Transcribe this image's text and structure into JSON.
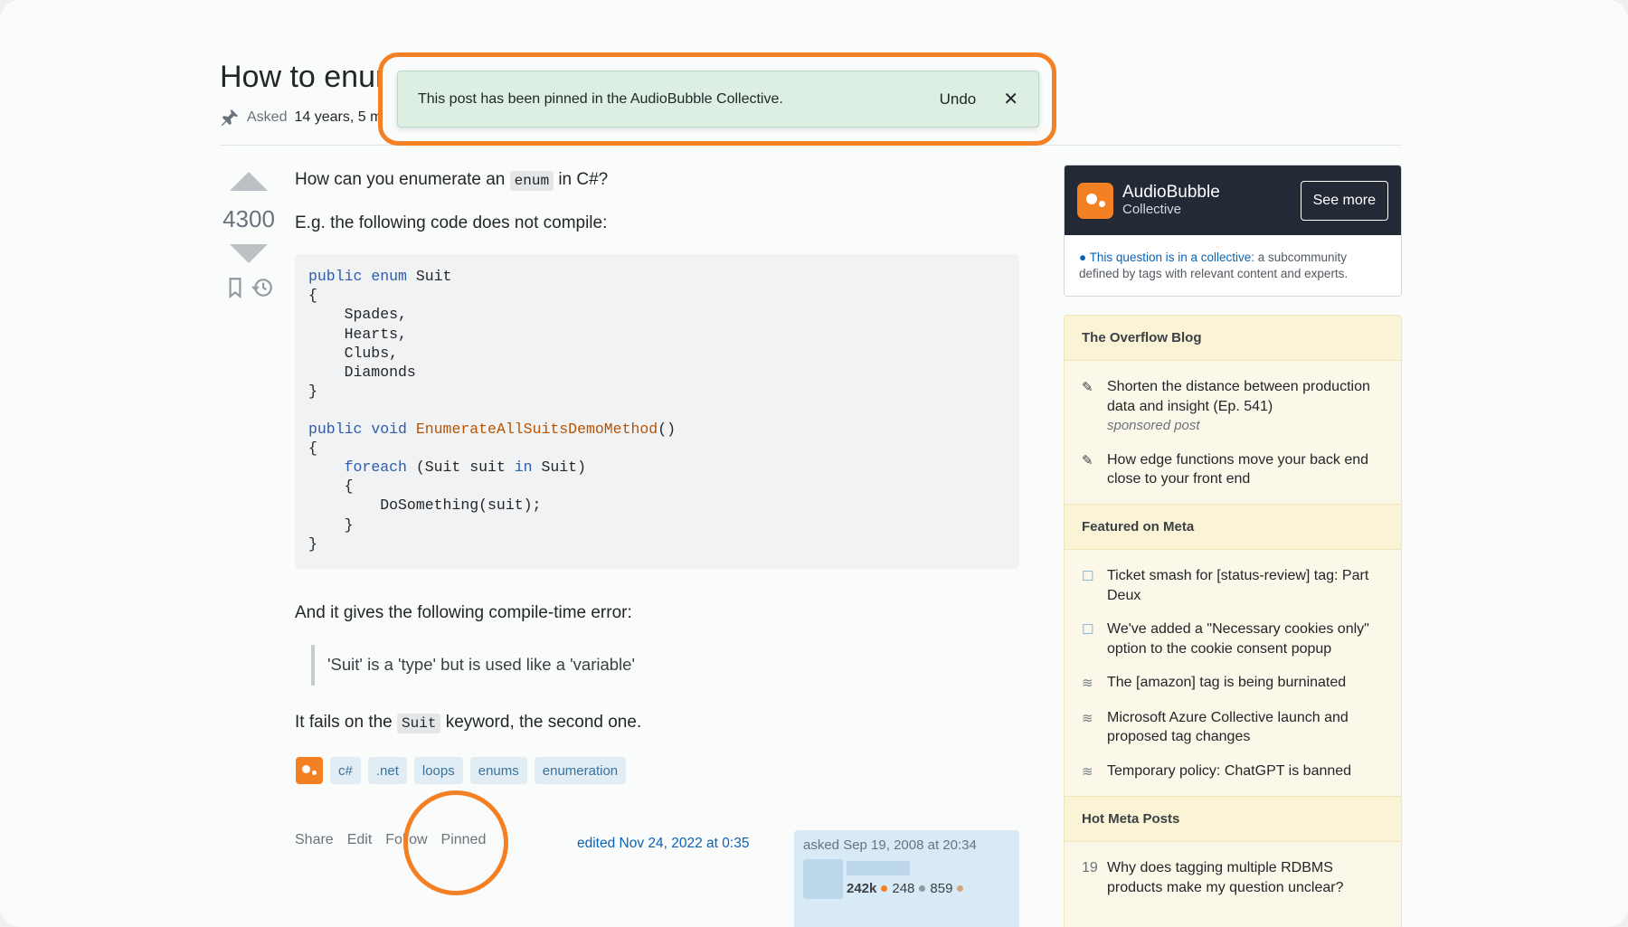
{
  "question": {
    "title": "How to enumerate an enum?",
    "asked_label": "Asked",
    "asked_value": "14 years, 5 months ago",
    "score": "4300",
    "body": {
      "p1_before": "How can you enumerate an ",
      "p1_code": "enum",
      "p1_after": " in C#?",
      "p2": "E.g. the following code does not compile:",
      "p3": "And it gives the following compile-time error:",
      "quote": "'Suit' is a 'type' but is used like a 'variable'",
      "p4_before": "It fails on the ",
      "p4_code": "Suit",
      "p4_after": " keyword, the second one."
    },
    "code": {
      "l1_kw1": "public",
      "l1_kw2": "enum",
      "l1_rest": " Suit",
      "l2": "{",
      "l3": "    Spades,",
      "l4": "    Hearts,",
      "l5": "    Clubs,",
      "l6": "    Diamonds",
      "l7": "}",
      "l9_kw1": "public",
      "l9_kw2": "void",
      "l9_fn": "EnumerateAllSuitsDemoMethod",
      "l9_rest": "()",
      "l10": "{",
      "l11_kw": "foreach",
      "l11_mid": " (Suit suit ",
      "l11_kw2": "in",
      "l11_rest": " Suit)",
      "l12": "    {",
      "l13": "        DoSomething(suit);",
      "l14": "    }",
      "l15": "}"
    },
    "tags": [
      "c#",
      ".net",
      "loops",
      "enums",
      "enumeration"
    ],
    "actions": [
      "Share",
      "Edit",
      "Follow",
      "Pinned"
    ],
    "edited": "edited Nov 24, 2022 at 0:35",
    "asked_on": "asked Sep 19, 2008 at 20:34",
    "owner_rep": "242k",
    "owner_silver": "248",
    "owner_bronze": "859"
  },
  "toast": {
    "message": "This post has been pinned in the AudioBubble Collective.",
    "undo": "Undo",
    "close": "✕"
  },
  "collective": {
    "name": "AudioBubble",
    "sub": "Collective",
    "see_more": "See more",
    "note_link": "This question is in a collective:",
    "note_rest": " a subcommunity defined by tags with relevant content and experts."
  },
  "sidebar": {
    "blog_title": "The Overflow Blog",
    "blog_items": [
      {
        "text": "Shorten the distance between production data and insight (Ep. 541)",
        "sub": "sponsored post"
      },
      {
        "text": "How edge functions move your back end close to your front end",
        "sub": ""
      }
    ],
    "meta_title": "Featured on Meta",
    "meta_items": [
      "Ticket smash for [status-review] tag: Part Deux",
      "We've added a \"Necessary cookies only\" option to the cookie consent popup",
      "The [amazon] tag is being burninated",
      "Microsoft Azure Collective launch and proposed tag changes",
      "Temporary policy: ChatGPT is banned"
    ],
    "hot_title": "Hot Meta Posts",
    "hot_items": [
      {
        "num": "19",
        "text": "Why does tagging multiple RDBMS products make my question unclear?"
      }
    ]
  },
  "colors": {
    "accent": "#f48024",
    "toast_bg": "#dcefe2",
    "link": "#0a62b3"
  }
}
